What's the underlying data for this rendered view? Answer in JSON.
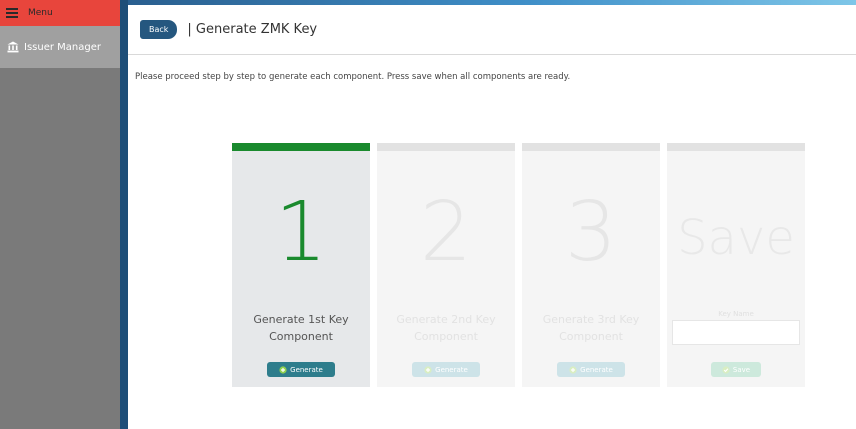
{
  "sidebar": {
    "menu_label": "Menu",
    "items": [
      {
        "label": "Issuer Manager",
        "icon": "bank-icon"
      }
    ]
  },
  "header": {
    "back_label": "Back",
    "title": "| Generate ZMK Key"
  },
  "instructions": "Please proceed step by step to generate each component. Press save when all components are ready.",
  "steps": [
    {
      "number": "1",
      "caption_line1": "Generate 1st Key",
      "caption_line2": "Component",
      "button_label": "Generate",
      "active": true
    },
    {
      "number": "2",
      "caption_line1": "Generate 2nd Key",
      "caption_line2": "Component",
      "button_label": "Generate",
      "active": false
    },
    {
      "number": "3",
      "caption_line1": "Generate 3rd Key",
      "caption_line2": "Component",
      "button_label": "Generate",
      "active": false
    }
  ],
  "save_step": {
    "title": "Save",
    "key_name_label": "Key Name",
    "key_name_value": "",
    "button_label": "Save"
  },
  "colors": {
    "accent_green": "#1a8a2e",
    "menu_red": "#e8453c",
    "back_blue": "#25577f",
    "sidebar_border": "#1e4e78"
  }
}
